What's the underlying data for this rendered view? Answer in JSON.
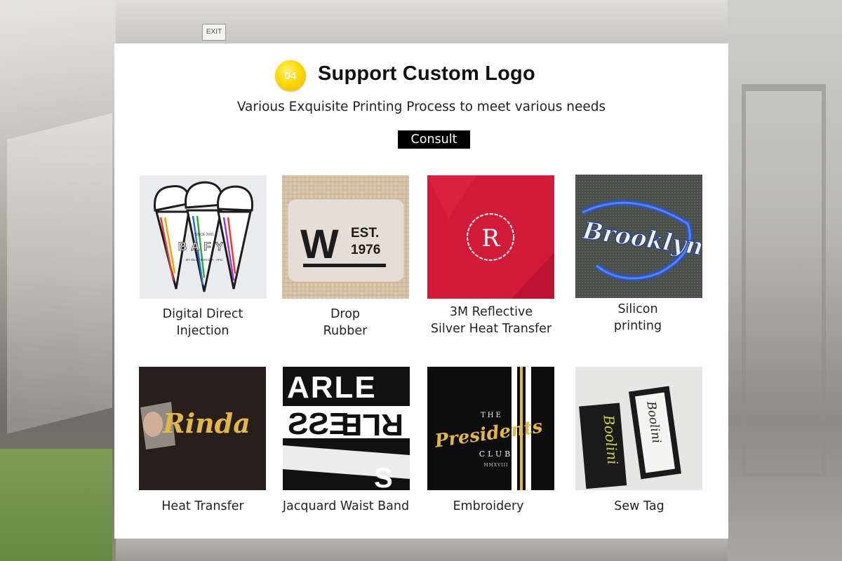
{
  "background": {
    "exit_sign": "EXIT"
  },
  "header": {
    "badge_number": "04",
    "title": "Support Custom Logo",
    "subtitle": "Various Exquisite Printing Process to meet various needs",
    "consult_label": "Consult"
  },
  "products": [
    {
      "line1": "Digital Direct",
      "line2": "Injection",
      "icon": "ice-cream-print-image",
      "image_text": {
        "brand": "BAFY",
        "small": "SINCE 2001",
        "tagline": "BY ISLA · BOGOTA · AFC"
      }
    },
    {
      "line1": "Drop",
      "line2": "Rubber",
      "icon": "rubber-patch-image",
      "image_text": {
        "letter": "W",
        "est": "EST.",
        "year": "1976"
      }
    },
    {
      "line1": "3M Reflective",
      "line2": "Silver Heat Transfer",
      "icon": "reflective-logo-image",
      "image_text": {
        "letter": "R"
      }
    },
    {
      "line1": "Silicon",
      "line2": "printing",
      "icon": "silicone-logo-image",
      "image_text": {
        "script": "Brooklyn"
      }
    },
    {
      "line1": "Heat Transfer",
      "line2": "",
      "icon": "gold-heat-transfer-image",
      "image_text": {
        "script": "Rinda"
      }
    },
    {
      "line1": "Jacquard Waist Band",
      "line2": "",
      "icon": "waistband-image",
      "image_text": {
        "row1": "ARLE",
        "row2": "ESS",
        "row3": "RLE",
        "row4": "S"
      }
    },
    {
      "line1": "Embroidery",
      "line2": "",
      "icon": "embroidery-image",
      "image_text": {
        "the": "THE",
        "script": "Presidents",
        "club": "CLUB",
        "roman": "MMXVIII"
      }
    },
    {
      "line1": "Sew Tag",
      "line2": "",
      "icon": "woven-tag-image",
      "image_text": {
        "tag1": "Boolini",
        "tag2": "Boolini"
      }
    }
  ],
  "colors": {
    "badge": "#ffd800",
    "consult_bg": "#000000",
    "reflective_bg": "#d21a3a",
    "silicone_bg": "#4b4f4a",
    "gold": "#e1b64a"
  }
}
